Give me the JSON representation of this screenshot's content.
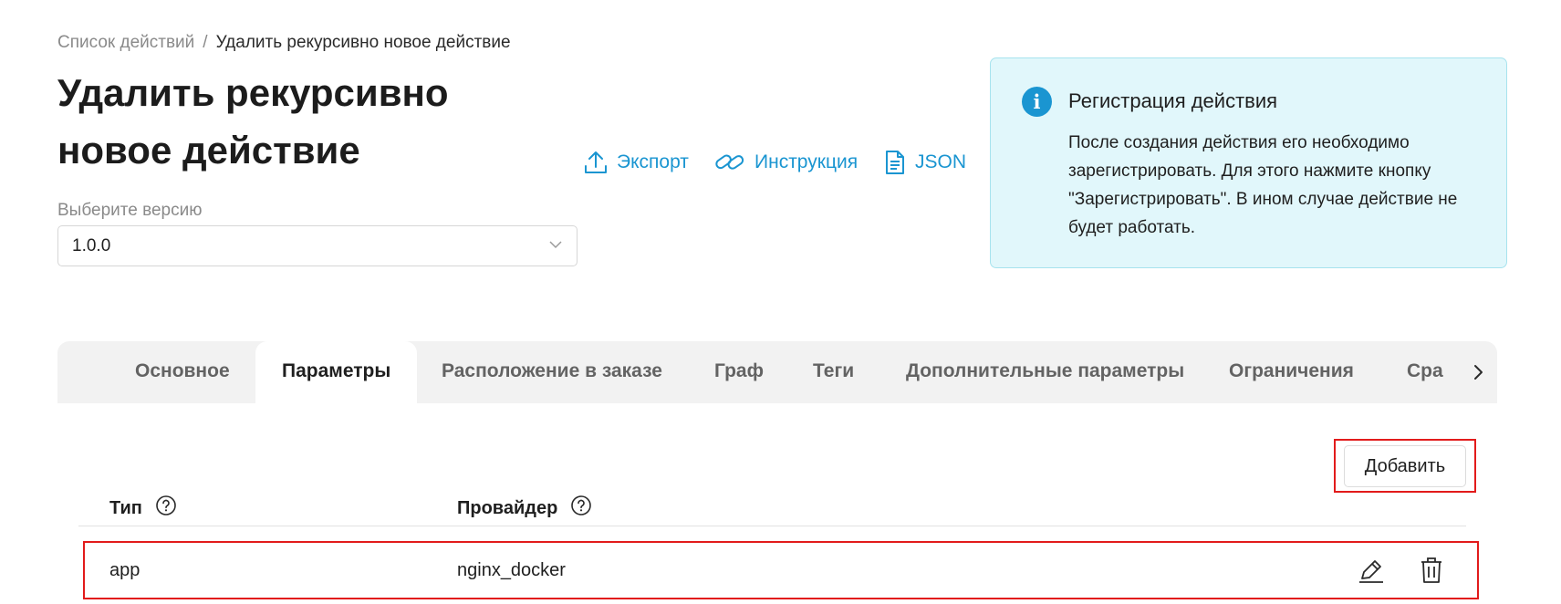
{
  "breadcrumb": {
    "parent": "Список действий",
    "separator": "/",
    "current": "Удалить рекурсивно новое действие"
  },
  "page_title": "Удалить рекурсивно новое действие",
  "version": {
    "label": "Выберите версию",
    "selected": "1.0.0",
    "icon": "chevron-down-icon"
  },
  "actions": {
    "export": {
      "label": "Экспорт",
      "icon": "upload-icon"
    },
    "instruction": {
      "label": "Инструкция",
      "icon": "link-icon"
    },
    "json": {
      "label": "JSON",
      "icon": "document-icon"
    }
  },
  "info": {
    "title": "Регистрация действия",
    "text": "После создания действия его необходимо зарегистрировать. Для этого нажмите кнопку \"Зарегистрировать\". В ином случае действие не будет работать.",
    "icon": "info-icon"
  },
  "tabs": [
    {
      "label": "Основное",
      "active": false
    },
    {
      "label": "Параметры",
      "active": true
    },
    {
      "label": "Расположение в заказе",
      "active": false
    },
    {
      "label": "Граф",
      "active": false
    },
    {
      "label": "Теги",
      "active": false
    },
    {
      "label": "Дополнительные параметры",
      "active": false
    },
    {
      "label": "Ограничения",
      "active": false
    },
    {
      "label": "Сра",
      "active": false
    }
  ],
  "add_button": {
    "label": "Добавить"
  },
  "table": {
    "columns": [
      {
        "label": "Тип",
        "help_icon": "question-circle-icon"
      },
      {
        "label": "Провайдер",
        "help_icon": "question-circle-icon"
      }
    ],
    "rows": [
      {
        "type": "app",
        "provider": "nginx_docker",
        "edit_icon": "pencil-icon",
        "delete_icon": "trash-icon"
      }
    ]
  },
  "colors": {
    "accent": "#1a95d1",
    "info_bg": "#e1f7fb",
    "info_border": "#a7e3ee",
    "highlight": "#e21b1b",
    "tabs_bg": "#f2f2f2"
  }
}
